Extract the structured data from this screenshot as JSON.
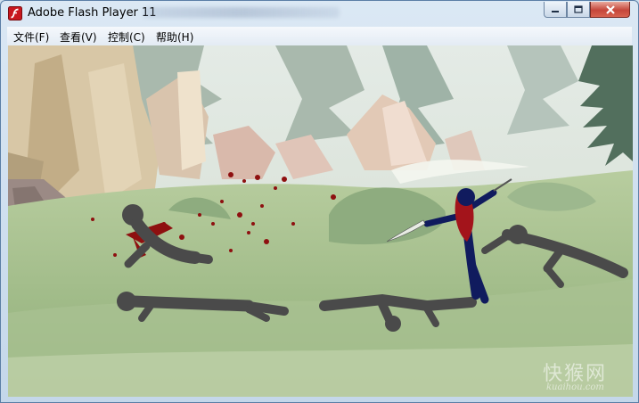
{
  "window": {
    "title": "Adobe Flash Player 11"
  },
  "menu": [
    {
      "label": "文件(F)"
    },
    {
      "label": "查看(V)"
    },
    {
      "label": "控制(C)"
    },
    {
      "label": "帮助(H)"
    }
  ],
  "watermark": {
    "text": "快猴网",
    "sub": "kuaihou.com"
  },
  "colors": {
    "title_bar": "#dbe8f4",
    "close_button": "#c5463a",
    "stickman_gray": "#4a4a4a",
    "player_blue": "#101b5e",
    "player_hair": "#a3141b",
    "blood": "#8e1010"
  },
  "icons": [
    "flash-app-icon",
    "minimize-icon",
    "maximize-icon",
    "close-icon"
  ]
}
